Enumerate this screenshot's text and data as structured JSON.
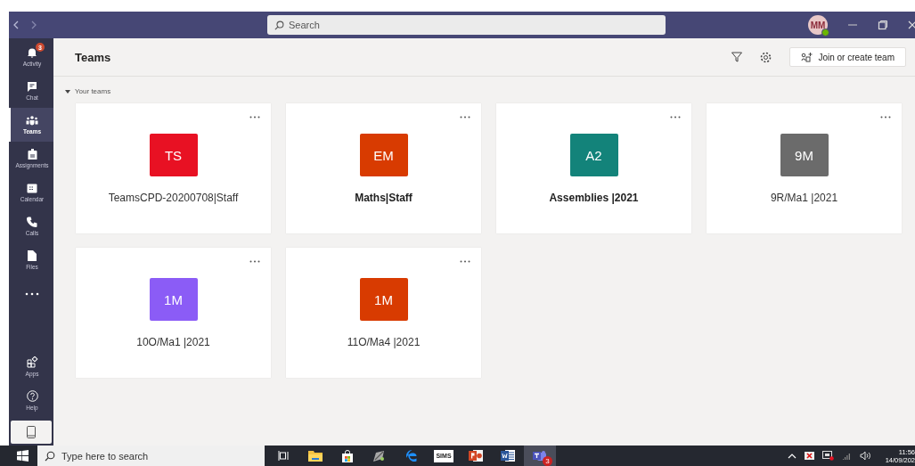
{
  "search": {
    "placeholder": "Search"
  },
  "user": {
    "initials": "MM",
    "online": true
  },
  "rail": [
    {
      "kind": "activity",
      "label": "Activity",
      "badge": "3",
      "selected": false
    },
    {
      "kind": "chat",
      "label": "Chat",
      "selected": false
    },
    {
      "kind": "teams",
      "label": "Teams",
      "selected": true
    },
    {
      "kind": "assignments",
      "label": "Assignments",
      "selected": false
    },
    {
      "kind": "calendar",
      "label": "Calendar",
      "selected": false
    },
    {
      "kind": "calls",
      "label": "Calls",
      "selected": false
    },
    {
      "kind": "files",
      "label": "Files",
      "selected": false
    },
    {
      "kind": "more",
      "selected": false
    }
  ],
  "rail_bottom": [
    {
      "kind": "apps",
      "label": "Apps",
      "selected": false
    },
    {
      "kind": "help",
      "label": "Help",
      "selected": false
    }
  ],
  "page": {
    "title": "Teams",
    "join_button": "Join or create team"
  },
  "section": {
    "label": "Your teams",
    "expanded": true
  },
  "teams": [
    {
      "initials": "TS",
      "name": "TeamsCPD-20200708|Staff",
      "color": "#e81123",
      "unread": false
    },
    {
      "initials": "EM",
      "name": "Maths|Staff",
      "color": "#d83b01",
      "unread": true
    },
    {
      "initials": "A2",
      "name": "Assemblies |2021",
      "color": "#13837a",
      "unread": true
    },
    {
      "initials": "9M",
      "name": "9R/Ma1 |2021",
      "color": "#6b6b6b",
      "unread": false
    },
    {
      "initials": "1M",
      "name": "10O/Ma1 |2021",
      "color": "#8b5cf6",
      "unread": false
    },
    {
      "initials": "1M",
      "name": "11O/Ma4 |2021",
      "color": "#d83b01",
      "unread": false
    }
  ],
  "taskbar": {
    "search_placeholder": "Type here to search",
    "apps": [
      {
        "kind": "task-view",
        "selected": false
      },
      {
        "kind": "folder",
        "selected": false
      },
      {
        "kind": "store",
        "selected": false
      },
      {
        "kind": "tool",
        "selected": false
      },
      {
        "kind": "edge",
        "selected": false
      },
      {
        "kind": "sims",
        "label": "SIMS",
        "selected": false
      },
      {
        "kind": "powerpoint",
        "selected": false
      },
      {
        "kind": "word",
        "selected": false
      },
      {
        "kind": "teams",
        "badge": "3",
        "selected": true
      }
    ],
    "time": "11:56",
    "date": "14/09/202"
  }
}
